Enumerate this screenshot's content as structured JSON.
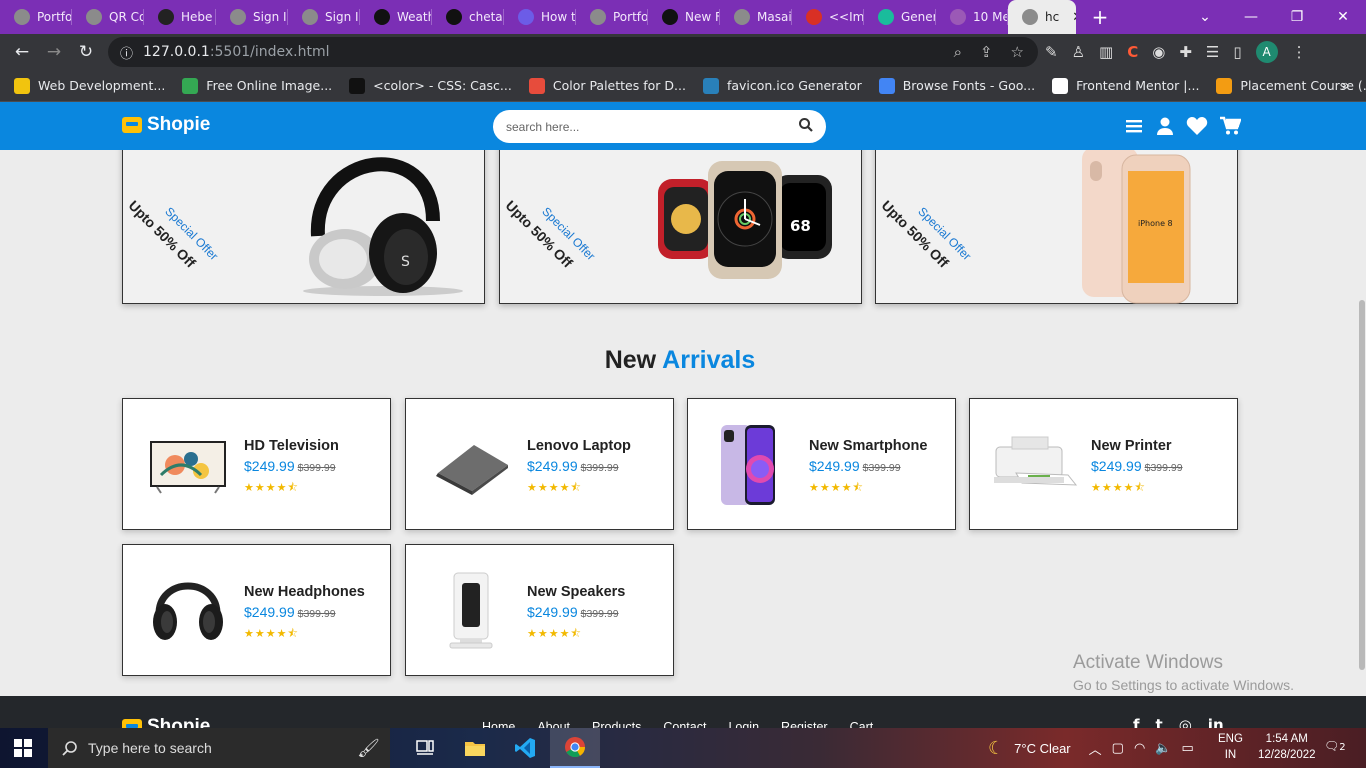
{
  "browser": {
    "tabs": [
      {
        "title": "Portfo",
        "icon": "globe-icon",
        "color": "#8b8b8b"
      },
      {
        "title": "QR Co",
        "icon": "qr-icon",
        "color": "#8b8b8b"
      },
      {
        "title": "Hebe",
        "icon": "hashnode-icon",
        "color": "#222222"
      },
      {
        "title": "Sign In",
        "icon": "globe-icon",
        "color": "#8b8b8b"
      },
      {
        "title": "Sign In",
        "icon": "globe-icon",
        "color": "#8b8b8b"
      },
      {
        "title": "Weath",
        "icon": "github-icon",
        "color": "#111111"
      },
      {
        "title": "chetar",
        "icon": "github-icon",
        "color": "#111111"
      },
      {
        "title": "How t",
        "icon": "mail-icon",
        "color": "#6c5ce7"
      },
      {
        "title": "Portfo",
        "icon": "globe-icon",
        "color": "#8b8b8b"
      },
      {
        "title": "New F",
        "icon": "github-icon",
        "color": "#111111"
      },
      {
        "title": "Masai",
        "icon": "globe-icon",
        "color": "#8b8b8b"
      },
      {
        "title": "<<Im",
        "icon": "gmail-icon",
        "color": "#d93025"
      },
      {
        "title": "Gener",
        "icon": "diamond-icon",
        "color": "#1abc9c"
      },
      {
        "title": "10 Me",
        "icon": "shield-icon",
        "color": "#9b59b6"
      },
      {
        "title": "hc",
        "icon": "globe-icon",
        "color": "#8b8b8b",
        "active": true
      }
    ],
    "url_host": "127.0.0.1",
    "url_rest": ":5501/index.html",
    "profile_initial": "A",
    "bookmarks": [
      {
        "label": "Web Development...",
        "color": "#f1c40f"
      },
      {
        "label": "Free Online Image...",
        "color": "#34a853"
      },
      {
        "label": "<color> - CSS: Casc...",
        "color": "#111111"
      },
      {
        "label": "Color Palettes for D...",
        "color": "#e74c3c"
      },
      {
        "label": "favicon.ico Generator",
        "color": "#2980b9"
      },
      {
        "label": "Browse Fonts - Goo...",
        "color": "#4285f4"
      },
      {
        "label": "Frontend Mentor |...",
        "color": "#ffffff"
      },
      {
        "label": "Placement Course (...",
        "color": "#f39c12"
      }
    ]
  },
  "site": {
    "brand": "Shopie",
    "search_placeholder": "search here...",
    "accent": "#0a87df",
    "offers": [
      {
        "line1": "Special Offer",
        "line2": "Upto 50% Off",
        "product": "headphones"
      },
      {
        "line1": "Special Offer",
        "line2": "Upto 50% Off",
        "product": "smartwatches"
      },
      {
        "line1": "Special Offer",
        "line2": "Upto 50% Off",
        "product": "iPhone 8",
        "screen_text": "iPhone 8"
      }
    ],
    "section_title_a": "New",
    "section_title_b": "Arrivals",
    "products": [
      {
        "name": "HD Television",
        "price": "$249.99",
        "old_price": "$399.99",
        "rating": 4.5
      },
      {
        "name": "Lenovo Laptop",
        "price": "$249.99",
        "old_price": "$399.99",
        "rating": 4.5
      },
      {
        "name": "New Smartphone",
        "price": "$249.99",
        "old_price": "$399.99",
        "rating": 4.5
      },
      {
        "name": "New Printer",
        "price": "$249.99",
        "old_price": "$399.99",
        "rating": 4.5
      },
      {
        "name": "New Headphones",
        "price": "$249.99",
        "old_price": "$399.99",
        "rating": 4.5
      },
      {
        "name": "New Speakers",
        "price": "$249.99",
        "old_price": "$399.99",
        "rating": 4.5
      }
    ],
    "footer_links": [
      "Home",
      "About",
      "Products",
      "Contact",
      "Login",
      "Register",
      "Cart"
    ]
  },
  "watermark": {
    "line1": "Activate Windows",
    "line2": "Go to Settings to activate Windows."
  },
  "taskbar": {
    "search_placeholder": "Type here to search",
    "weather": "7°C  Clear",
    "lang1": "ENG",
    "lang2": "IN",
    "time": "1:54 AM",
    "date": "12/28/2022",
    "notifications": "2"
  }
}
